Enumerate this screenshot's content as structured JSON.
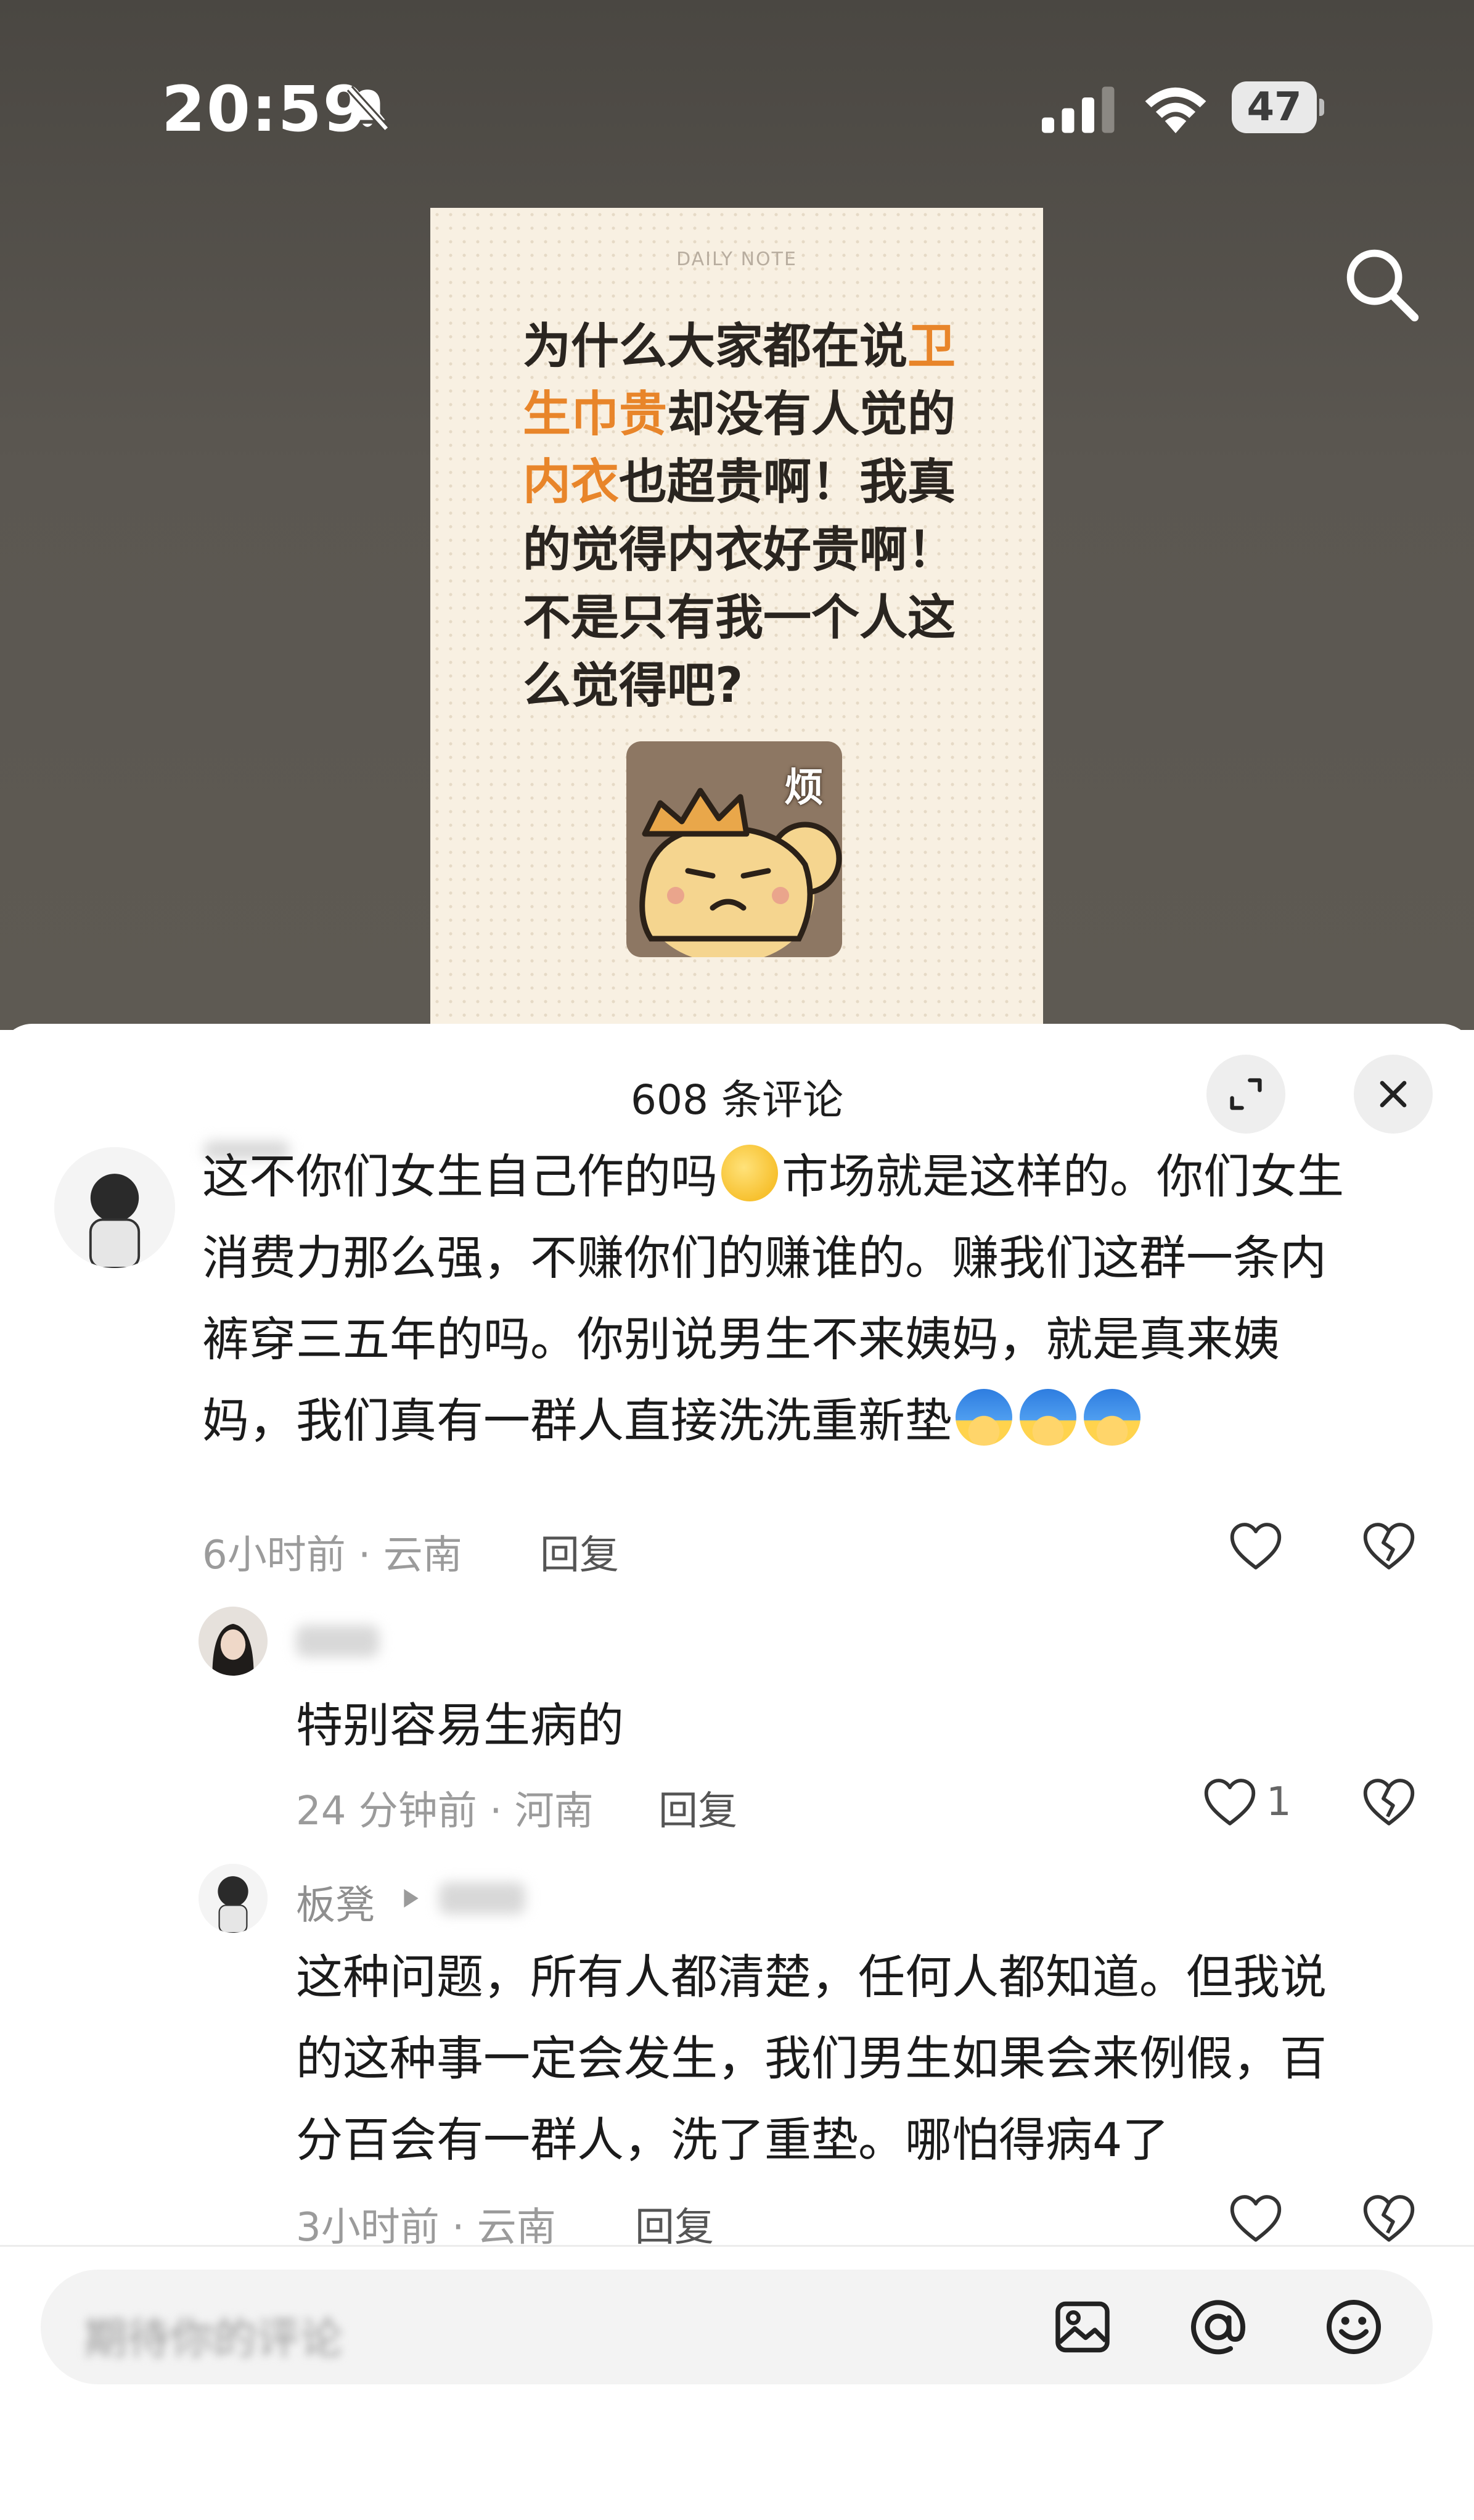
{
  "status_bar": {
    "time": "20:59",
    "battery": "47",
    "icons": [
      "bell-off-icon",
      "signal-icon",
      "wifi-icon",
      "battery-icon"
    ]
  },
  "post": {
    "search_icon": "search-icon",
    "note_label": "DAILY NOTE",
    "note_lines": [
      [
        {
          "t": "为什么大家都在说",
          "hl": false
        },
        {
          "t": "卫",
          "hl": true
        }
      ],
      [
        {
          "t": "生巾贵",
          "hl": true
        },
        {
          "t": "却没有人觉的",
          "hl": false
        }
      ],
      [
        {
          "t": "内衣",
          "hl": true
        },
        {
          "t": "也超贵啊！我真",
          "hl": false
        }
      ],
      [
        {
          "t": "的觉得内衣好贵啊！",
          "hl": false
        }
      ],
      [
        {
          "t": "不是只有我一个人这",
          "hl": false
        }
      ],
      [
        {
          "t": "么觉得吧?",
          "hl": false
        }
      ]
    ],
    "sticker_word": "烦",
    "highlight_color": "#e8852a"
  },
  "comments_panel": {
    "title": "608 条评论",
    "comments": [
      {
        "text_parts": [
          "这不你们女生自己作的吗",
          "市场就是这样的。你们女生\n消费力那么强，不赚你们的赚谁的。赚我们这群一条内\n裤穿三五年的吗。你别说男生不来姨妈，就是真来姨\n妈，我们真有一群人直接洗洗重新垫"
        ],
        "meta": "6小时前 · 云南",
        "reply": "回复"
      },
      {
        "text": "特别容易生病的",
        "meta": "24 分钟前 · 河南",
        "reply": "回复",
        "likes": "1"
      },
      {
        "author": "板凳",
        "text": "这种问题，所有人都清楚，任何人都知道。但我说\n的这种事一定会发生，我们男生如果会来例假，百\n分百会有一群人，洗了重垫。哪怕得病4了",
        "meta": "3小时前 · 云南",
        "reply": "回复"
      }
    ]
  },
  "input_bar": {
    "placeholder": "期待你的评论",
    "icons": [
      "image-icon",
      "at-icon",
      "emoji-icon"
    ]
  }
}
